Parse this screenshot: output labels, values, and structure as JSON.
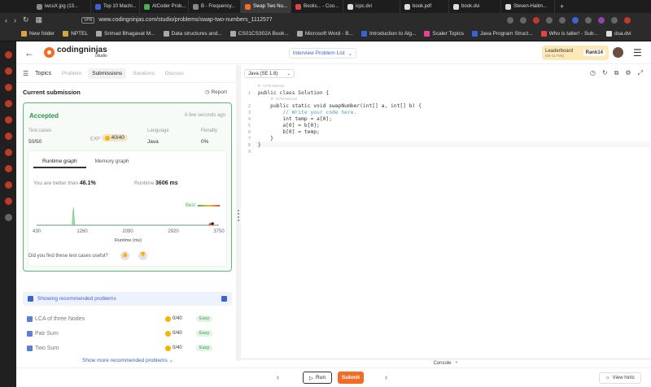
{
  "browser": {
    "tabs": [
      {
        "label": "iwcuX.jpg (13..."
      },
      {
        "label": "Top 10 Machi..."
      },
      {
        "label": "AtCoder Prob..."
      },
      {
        "label": "B - Frequency..."
      },
      {
        "label": "Swap Two Nu..."
      },
      {
        "label": "Books... - Coo..."
      },
      {
        "label": "icpc.dvi"
      },
      {
        "label": "book.pdf"
      },
      {
        "label": "book.dvi"
      },
      {
        "label": "Steven-Halim..."
      }
    ],
    "url": "www.codingninjas.com/studio/problems/swap-two-numbers_1112577",
    "vpn_label": "VPN",
    "bookmarks": [
      "New folder",
      "NPTEL",
      "Srimad Bhagavat M...",
      "Data structures and...",
      "CS01CS302A Book...",
      "Microsoft Word - B...",
      "Introduction to Alg...",
      "Scaler Topics",
      "Java Program Struct...",
      "Who is taller! - Sub...",
      "dsa.dvi"
    ]
  },
  "header": {
    "logo_name": "codingninjas",
    "logo_sub": "/studio",
    "problem_list": "Interview Problem List",
    "leaderboard_title": "Leaderboard",
    "leaderboard_sub": "(05-11 Feb)",
    "rank": "Rank14"
  },
  "left_tabs": [
    "Topics",
    "Problem",
    "Submissions",
    "Solutions",
    "Discuss"
  ],
  "submission": {
    "section_title": "Current submission",
    "report": "Report",
    "status": "Accepted",
    "time_ago": "A few seconds ago",
    "test_cases_label": "Test cases",
    "test_cases_value": "50/50",
    "exp_label": "EXP",
    "exp_value": "40/40",
    "language_label": "Language",
    "language_value": "Java",
    "penalty_label": "Penalty",
    "penalty_value": "0%",
    "graph_tabs": [
      "Runtime graph",
      "Memory graph"
    ],
    "better_text": "You are better than",
    "better_value": "46.1%",
    "runtime_label": "Runtime",
    "runtime_value": "3606 ms",
    "best_label": "Best",
    "useful_text": "Did you find these test cases useful?"
  },
  "chart_data": {
    "type": "area",
    "xlabel": "Runtime (ms)",
    "x_ticks": [
      430,
      1260,
      2090,
      2920,
      3750
    ],
    "xlim": [
      430,
      3750
    ],
    "series": [
      {
        "x": [
          430,
          1075,
          1100,
          1125,
          1160,
          3750
        ],
        "y": [
          0,
          0,
          1,
          0,
          0,
          0
        ]
      }
    ],
    "marker_x": 3606
  },
  "recommended": {
    "header": "Showing recommended problems",
    "problems": [
      {
        "name": "LCA of three Nodes",
        "points": "0/40",
        "difficulty": "Easy"
      },
      {
        "name": "Pair Sum",
        "points": "0/40",
        "difficulty": "Easy"
      },
      {
        "name": "Two Sum",
        "points": "0/40",
        "difficulty": "Easy"
      }
    ],
    "show_more": "Show more recommended problems"
  },
  "editor": {
    "language": "Java (SE 1.8)",
    "references": "0 references",
    "line_numbers": [
      "1",
      "2",
      "3",
      "4",
      "5",
      "6",
      "7",
      "8",
      "9"
    ],
    "lines": [
      "public class Solution {",
      "    public static void swapNumber(int[] a, int[] b) {",
      "        // Write your code here.",
      "        int temp = a[0];",
      "        a[0] = b[0];",
      "        b[0] = temp;",
      "    }",
      "}",
      ""
    ]
  },
  "footer": {
    "console": "Console",
    "run": "Run",
    "submit": "Submit",
    "view_hints": "View hints"
  }
}
